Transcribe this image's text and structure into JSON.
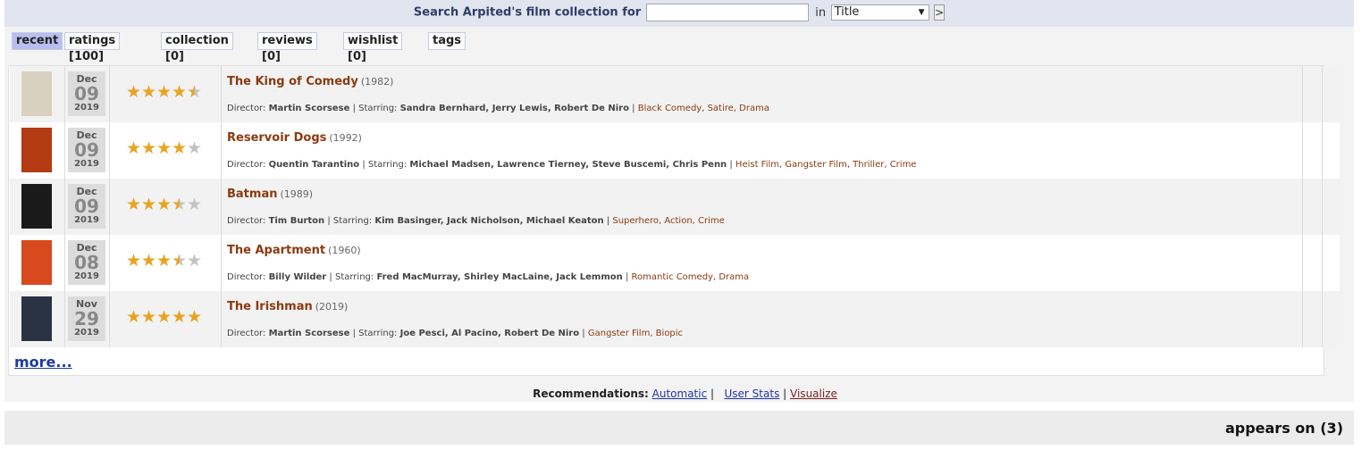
{
  "search": {
    "label": "Search Arpited's film collection for",
    "input_value": "",
    "in_label": "in",
    "select_value": "Title",
    "go_label": ">"
  },
  "tabs": [
    {
      "label": "recent",
      "active": true
    },
    {
      "label": "ratings [100]"
    },
    {
      "label": "collection [0]"
    },
    {
      "label": "reviews [0]"
    },
    {
      "label": "wishlist [0]"
    },
    {
      "label": "tags"
    }
  ],
  "films": [
    {
      "title": "The King of Comedy",
      "year": "(1982)",
      "month": "Dec",
      "day": "09",
      "yr": "2019",
      "rating": 4.5,
      "director_label": "Director:",
      "director": "Martin Scorsese",
      "starring_label": "Starring:",
      "starring": "Sandra Bernhard, Jerry Lewis, Robert De Niro",
      "genres": "Black Comedy, Satire, Drama",
      "poster_color": "#d8d0c0"
    },
    {
      "title": "Reservoir Dogs",
      "year": "(1992)",
      "month": "Dec",
      "day": "09",
      "yr": "2019",
      "rating": 4,
      "director_label": "Director:",
      "director": "Quentin Tarantino",
      "starring_label": "Starring:",
      "starring": "Michael Madsen, Lawrence Tierney, Steve Buscemi, Chris Penn",
      "genres": "Heist Film, Gangster Film, Thriller, Crime",
      "poster_color": "#b33a12"
    },
    {
      "title": "Batman",
      "year": "(1989)",
      "month": "Dec",
      "day": "09",
      "yr": "2019",
      "rating": 3.5,
      "director_label": "Director:",
      "director": "Tim Burton",
      "starring_label": "Starring:",
      "starring": "Kim Basinger, Jack Nicholson, Michael Keaton",
      "genres": "Superhero, Action, Crime",
      "poster_color": "#1a1a1a"
    },
    {
      "title": "The Apartment",
      "year": "(1960)",
      "month": "Dec",
      "day": "08",
      "yr": "2019",
      "rating": 3.5,
      "director_label": "Director:",
      "director": "Billy Wilder",
      "starring_label": "Starring:",
      "starring": "Fred MacMurray, Shirley MacLaine, Jack Lemmon",
      "genres": "Romantic Comedy, Drama",
      "poster_color": "#d84a1e"
    },
    {
      "title": "The Irishman",
      "year": "(2019)",
      "month": "Nov",
      "day": "29",
      "yr": "2019",
      "rating": 5,
      "director_label": "Director:",
      "director": "Martin Scorsese",
      "starring_label": "Starring:",
      "starring": "Joe Pesci, Al Pacino, Robert De Niro",
      "genres": "Gangster Film, Biopic",
      "poster_color": "#2a3344"
    }
  ],
  "more_label": "more...",
  "recommendations": {
    "label": "Recommendations:",
    "automatic": "Automatic",
    "sep1": "|",
    "user_stats": "User Stats",
    "sep2": "|",
    "visualize": "Visualize"
  },
  "appears_on": "appears on (3)",
  "colors": {
    "accent": "#8b3a0f",
    "tab_active": "#b8bff0",
    "star": "#e8a320"
  }
}
